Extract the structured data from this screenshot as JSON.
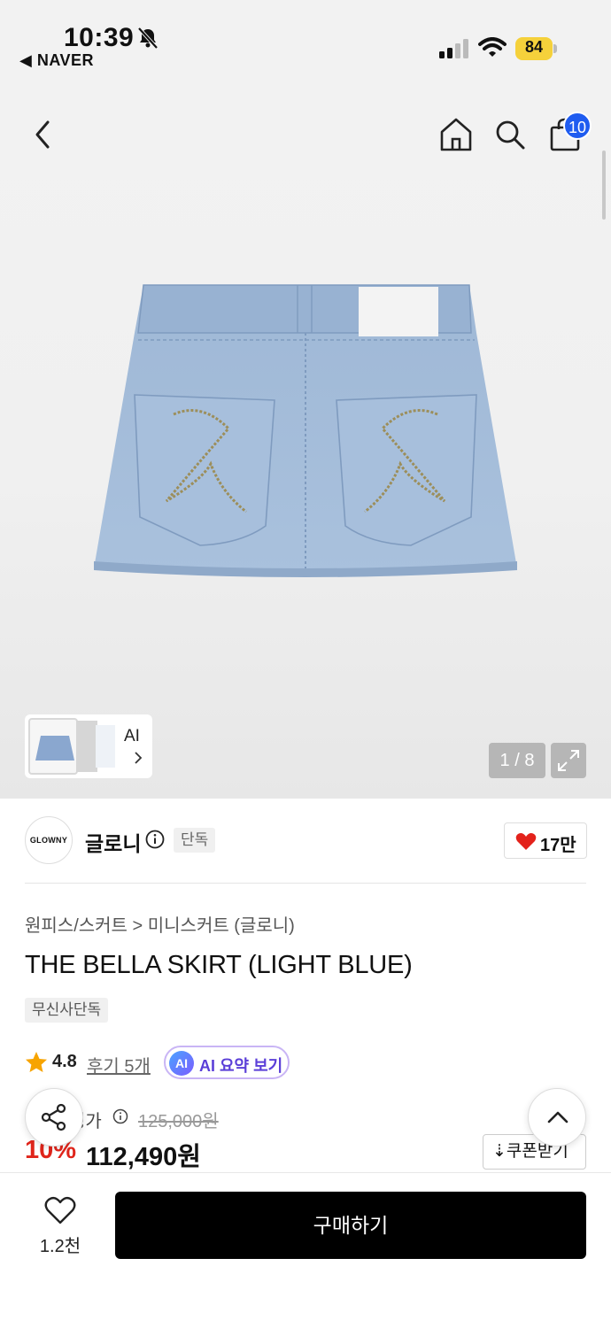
{
  "status_bar": {
    "time": "10:39",
    "back_app": "◀ NAVER",
    "battery": "84"
  },
  "header": {
    "bag_count": "10"
  },
  "gallery": {
    "thumb_ai_label": "AI",
    "pager": "1 / 8",
    "accent_color": "#1f5cf0"
  },
  "brand": {
    "logo_text": "GLOWNY",
    "name": "글로니",
    "exclusive_tag": "단독",
    "likes": "17만"
  },
  "product": {
    "breadcrumb": "원피스/스커트 > 미니스커트 (글로니)",
    "title": "THE BELLA SKIRT (LIGHT BLUE)",
    "store_tag": "무신사단독",
    "rating": "4.8",
    "reviews": "후기 5개",
    "ai_badge": "AI",
    "ai_summary": "AI 요약 보기",
    "price_label": "정가",
    "original_price": "125,000원",
    "discount": "10%",
    "sale_price": "112,490원",
    "coupon": "⇣쿠폰받기",
    "discount_color": "#e0251b"
  },
  "bottom_bar": {
    "wish_count": "1.2천",
    "buy_label": "구매하기"
  }
}
